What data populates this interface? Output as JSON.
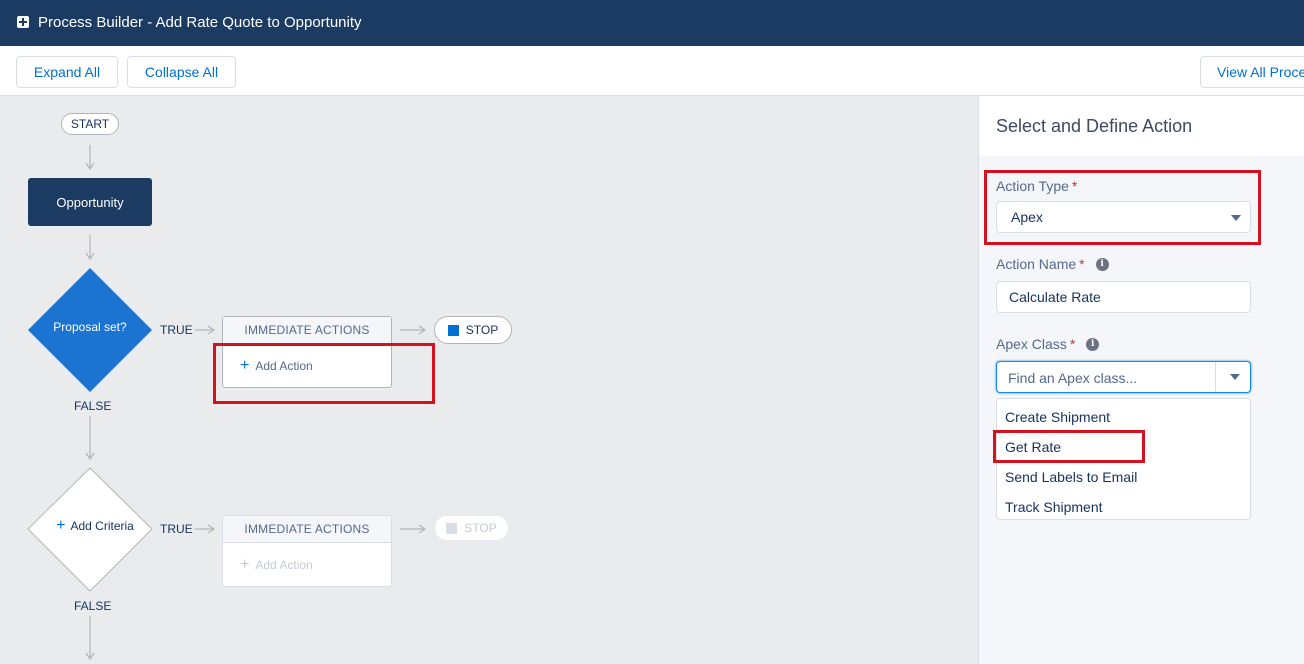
{
  "header": {
    "title": "Process Builder - Add Rate Quote to Opportunity"
  },
  "toolbar": {
    "expand_label": "Expand All",
    "collapse_label": "Collapse All",
    "view_all_label": "View All Proce"
  },
  "canvas": {
    "start_label": "START",
    "object_label": "Opportunity",
    "criteria": [
      {
        "label": "Proposal set?",
        "true_label": "TRUE",
        "false_label": "FALSE",
        "actions_header": "IMMEDIATE ACTIONS",
        "add_action_label": "Add Action",
        "stop_label": "STOP"
      },
      {
        "label": "Add Criteria",
        "true_label": "TRUE",
        "false_label": "FALSE",
        "actions_header": "IMMEDIATE ACTIONS",
        "add_action_label": "Add Action",
        "stop_label": "STOP"
      }
    ]
  },
  "panel": {
    "title": "Select and Define Action",
    "action_type": {
      "label": "Action Type",
      "required": "*",
      "value": "Apex"
    },
    "action_name": {
      "label": "Action Name",
      "required": "*",
      "value": "Calculate Rate"
    },
    "apex_class": {
      "label": "Apex Class",
      "required": "*",
      "placeholder": "Find an Apex class...",
      "options": [
        "Create Shipment",
        "Get Rate",
        "Send Labels to Email",
        "Track Shipment"
      ]
    }
  },
  "colors": {
    "header_bg": "#1b3b63",
    "accent": "#0070d2",
    "highlight": "#d3111f",
    "diamond_blue": "#1b74d1"
  }
}
